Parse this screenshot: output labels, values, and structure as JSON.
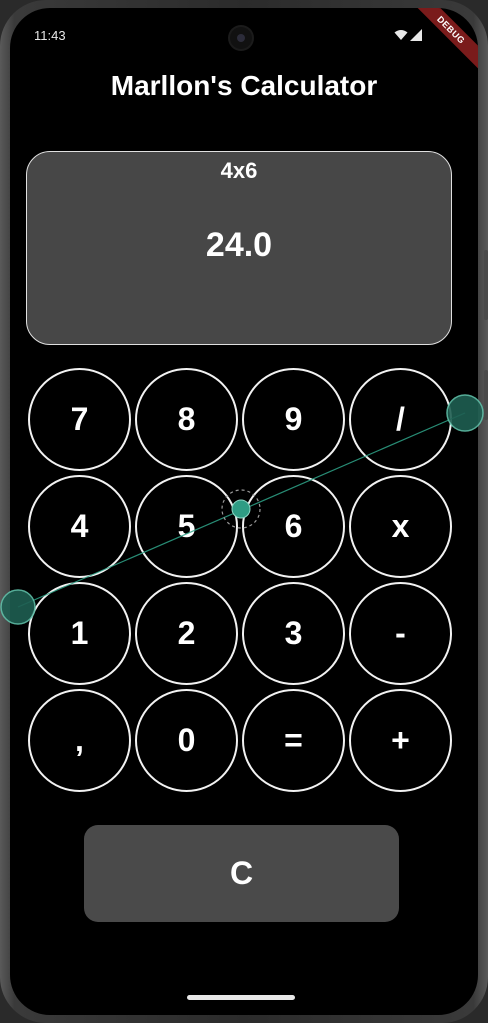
{
  "status_bar": {
    "time": "11:43",
    "debug_label": "DEBUG"
  },
  "app": {
    "title": "Marllon's Calculator"
  },
  "display": {
    "expression": "4x6",
    "result": "24.0"
  },
  "keypad": {
    "rows": [
      [
        "7",
        "8",
        "9",
        "/"
      ],
      [
        "4",
        "5",
        "6",
        "x"
      ],
      [
        "1",
        "2",
        "3",
        "-"
      ],
      [
        ",",
        "0",
        "=",
        "+"
      ]
    ]
  },
  "clear_button": {
    "label": "C"
  },
  "colors": {
    "background": "#000000",
    "display_bg": "#474747",
    "key_border": "#f2f2f2",
    "clear_bg": "#4a4a4a",
    "debug_banner": "#7a1b1b",
    "gesture_accent": "#2fa58a"
  },
  "icons": {
    "wifi": "wifi-icon",
    "signal": "cellular-signal-icon",
    "camera": "front-camera-icon"
  }
}
